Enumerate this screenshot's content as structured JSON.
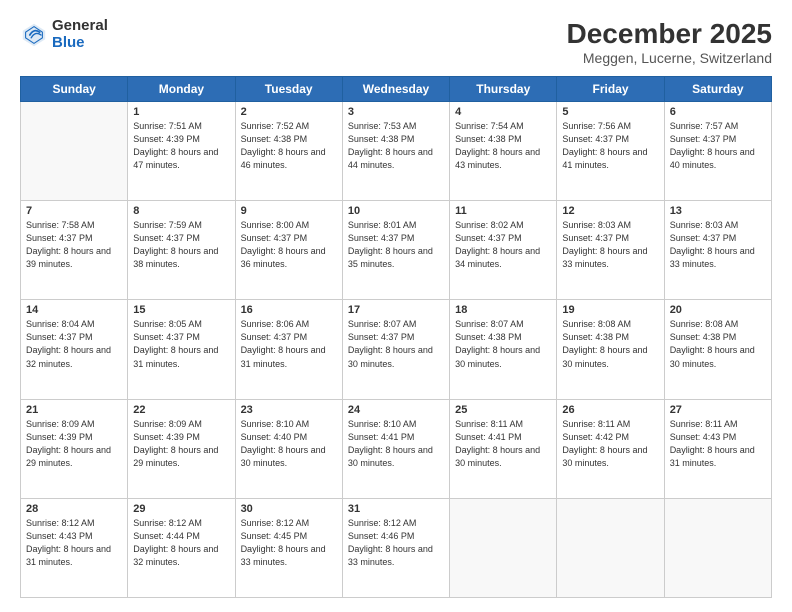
{
  "logo": {
    "general": "General",
    "blue": "Blue"
  },
  "header": {
    "title": "December 2025",
    "subtitle": "Meggen, Lucerne, Switzerland"
  },
  "weekdays": [
    "Sunday",
    "Monday",
    "Tuesday",
    "Wednesday",
    "Thursday",
    "Friday",
    "Saturday"
  ],
  "weeks": [
    [
      {
        "day": "",
        "empty": true
      },
      {
        "day": "1",
        "sunrise": "7:51 AM",
        "sunset": "4:39 PM",
        "daylight": "8 hours and 47 minutes."
      },
      {
        "day": "2",
        "sunrise": "7:52 AM",
        "sunset": "4:38 PM",
        "daylight": "8 hours and 46 minutes."
      },
      {
        "day": "3",
        "sunrise": "7:53 AM",
        "sunset": "4:38 PM",
        "daylight": "8 hours and 44 minutes."
      },
      {
        "day": "4",
        "sunrise": "7:54 AM",
        "sunset": "4:38 PM",
        "daylight": "8 hours and 43 minutes."
      },
      {
        "day": "5",
        "sunrise": "7:56 AM",
        "sunset": "4:37 PM",
        "daylight": "8 hours and 41 minutes."
      },
      {
        "day": "6",
        "sunrise": "7:57 AM",
        "sunset": "4:37 PM",
        "daylight": "8 hours and 40 minutes."
      }
    ],
    [
      {
        "day": "7",
        "sunrise": "7:58 AM",
        "sunset": "4:37 PM",
        "daylight": "8 hours and 39 minutes."
      },
      {
        "day": "8",
        "sunrise": "7:59 AM",
        "sunset": "4:37 PM",
        "daylight": "8 hours and 38 minutes."
      },
      {
        "day": "9",
        "sunrise": "8:00 AM",
        "sunset": "4:37 PM",
        "daylight": "8 hours and 36 minutes."
      },
      {
        "day": "10",
        "sunrise": "8:01 AM",
        "sunset": "4:37 PM",
        "daylight": "8 hours and 35 minutes."
      },
      {
        "day": "11",
        "sunrise": "8:02 AM",
        "sunset": "4:37 PM",
        "daylight": "8 hours and 34 minutes."
      },
      {
        "day": "12",
        "sunrise": "8:03 AM",
        "sunset": "4:37 PM",
        "daylight": "8 hours and 33 minutes."
      },
      {
        "day": "13",
        "sunrise": "8:03 AM",
        "sunset": "4:37 PM",
        "daylight": "8 hours and 33 minutes."
      }
    ],
    [
      {
        "day": "14",
        "sunrise": "8:04 AM",
        "sunset": "4:37 PM",
        "daylight": "8 hours and 32 minutes."
      },
      {
        "day": "15",
        "sunrise": "8:05 AM",
        "sunset": "4:37 PM",
        "daylight": "8 hours and 31 minutes."
      },
      {
        "day": "16",
        "sunrise": "8:06 AM",
        "sunset": "4:37 PM",
        "daylight": "8 hours and 31 minutes."
      },
      {
        "day": "17",
        "sunrise": "8:07 AM",
        "sunset": "4:37 PM",
        "daylight": "8 hours and 30 minutes."
      },
      {
        "day": "18",
        "sunrise": "8:07 AM",
        "sunset": "4:38 PM",
        "daylight": "8 hours and 30 minutes."
      },
      {
        "day": "19",
        "sunrise": "8:08 AM",
        "sunset": "4:38 PM",
        "daylight": "8 hours and 30 minutes."
      },
      {
        "day": "20",
        "sunrise": "8:08 AM",
        "sunset": "4:38 PM",
        "daylight": "8 hours and 30 minutes."
      }
    ],
    [
      {
        "day": "21",
        "sunrise": "8:09 AM",
        "sunset": "4:39 PM",
        "daylight": "8 hours and 29 minutes."
      },
      {
        "day": "22",
        "sunrise": "8:09 AM",
        "sunset": "4:39 PM",
        "daylight": "8 hours and 29 minutes."
      },
      {
        "day": "23",
        "sunrise": "8:10 AM",
        "sunset": "4:40 PM",
        "daylight": "8 hours and 30 minutes."
      },
      {
        "day": "24",
        "sunrise": "8:10 AM",
        "sunset": "4:41 PM",
        "daylight": "8 hours and 30 minutes."
      },
      {
        "day": "25",
        "sunrise": "8:11 AM",
        "sunset": "4:41 PM",
        "daylight": "8 hours and 30 minutes."
      },
      {
        "day": "26",
        "sunrise": "8:11 AM",
        "sunset": "4:42 PM",
        "daylight": "8 hours and 30 minutes."
      },
      {
        "day": "27",
        "sunrise": "8:11 AM",
        "sunset": "4:43 PM",
        "daylight": "8 hours and 31 minutes."
      }
    ],
    [
      {
        "day": "28",
        "sunrise": "8:12 AM",
        "sunset": "4:43 PM",
        "daylight": "8 hours and 31 minutes."
      },
      {
        "day": "29",
        "sunrise": "8:12 AM",
        "sunset": "4:44 PM",
        "daylight": "8 hours and 32 minutes."
      },
      {
        "day": "30",
        "sunrise": "8:12 AM",
        "sunset": "4:45 PM",
        "daylight": "8 hours and 33 minutes."
      },
      {
        "day": "31",
        "sunrise": "8:12 AM",
        "sunset": "4:46 PM",
        "daylight": "8 hours and 33 minutes."
      },
      {
        "day": "",
        "empty": true
      },
      {
        "day": "",
        "empty": true
      },
      {
        "day": "",
        "empty": true
      }
    ]
  ]
}
